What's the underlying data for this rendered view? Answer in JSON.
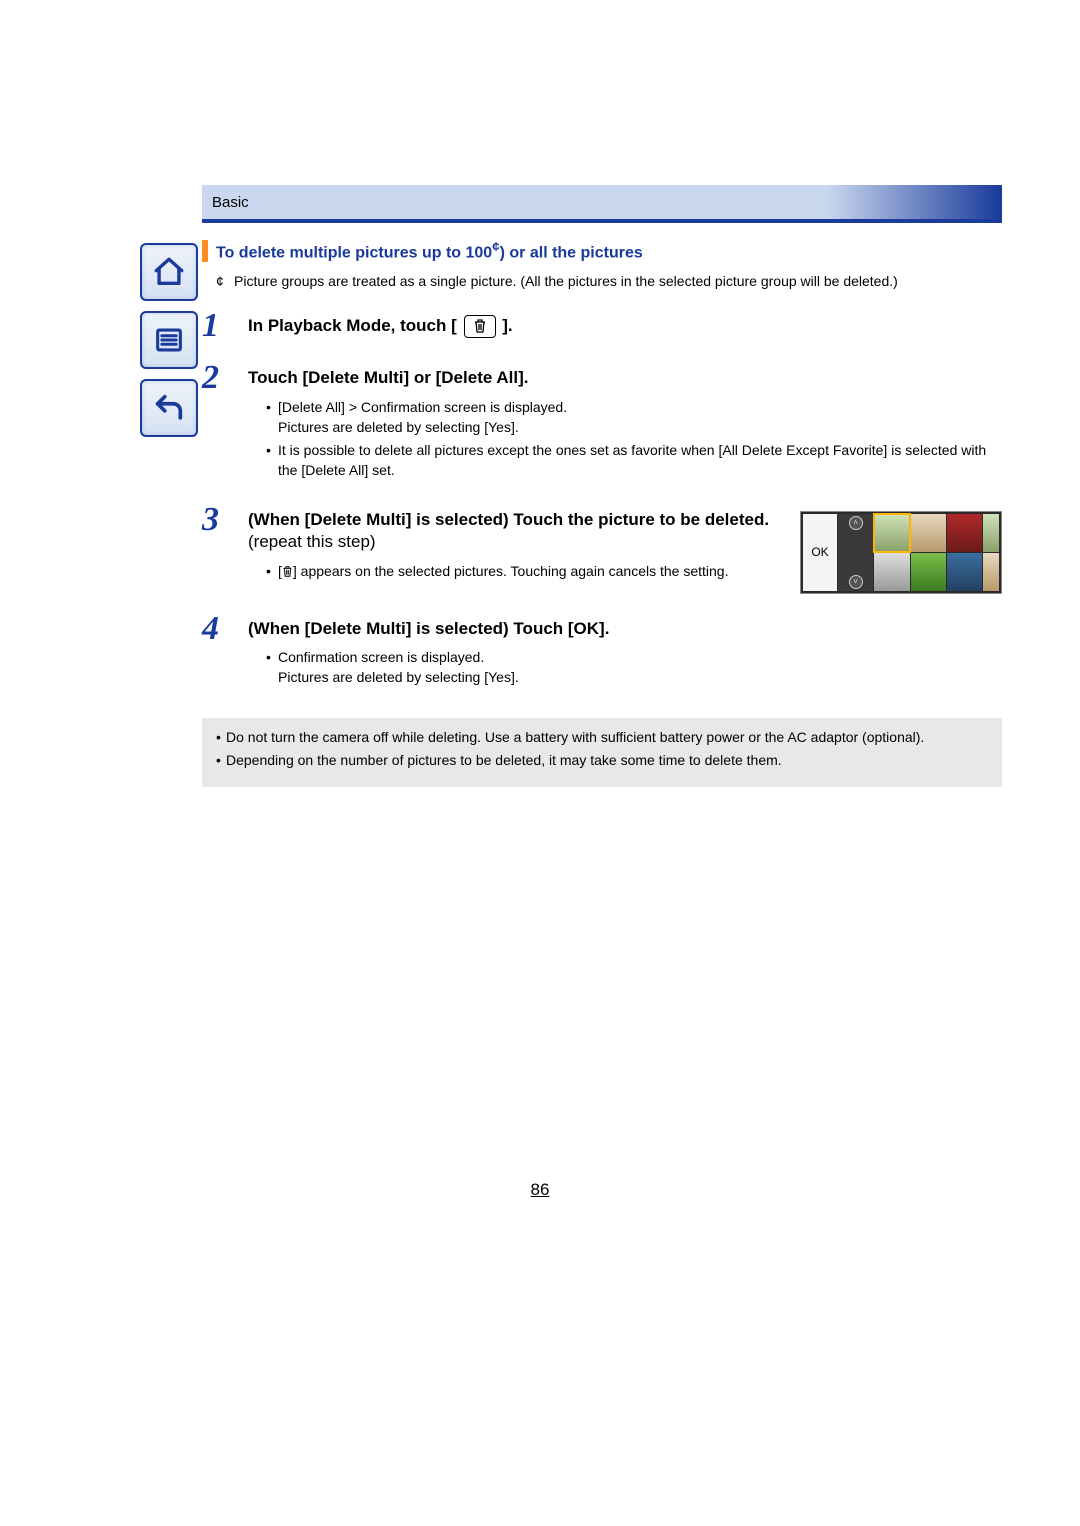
{
  "header": {
    "section": "Basic"
  },
  "heading": {
    "prefix": "To delete multiple pictures up to 100",
    "suffix": ") or all the pictures"
  },
  "footnote": {
    "mark": "¢",
    "text": "Picture groups are treated as a single picture. (All the pictures in the selected picture group will be deleted.)"
  },
  "steps": {
    "s1": {
      "num": "1",
      "t_before": "In Playback Mode, touch [",
      "t_after": "]."
    },
    "s2": {
      "num": "2",
      "title": "Touch [Delete Multi] or [Delete All].",
      "b1_a": "[Delete All] ",
      "b1_b": " Confirmation screen is displayed.",
      "b1_c": "Pictures are deleted by selecting [Yes].",
      "b2": "It is possible to delete all pictures except the ones set as favorite when [All Delete Except Favorite] is selected with the [Delete All] set."
    },
    "s3": {
      "num": "3",
      "title_bold": "When [Delete Multi] is selected) Touch the picture to be deleted.",
      "title_normal": " (repeat this step)",
      "b1_a": "[",
      "b1_b": "] appears on the selected pictures. Touching again cancels the setting."
    },
    "s4": {
      "num": "4",
      "title": "When [Delete Multi] is selected) Touch [OK].",
      "b1": "Confirmation screen is displayed.",
      "b2": "Pictures are deleted by selecting [Yes]."
    }
  },
  "thumb": {
    "ok": "OK"
  },
  "notes": {
    "n1": "Do not turn the camera off while deleting. Use a battery with sufficient battery power or the AC adaptor (optional).",
    "n2": "Depending on the number of pictures to be deleted, it may take some time to delete them."
  },
  "page_number": "86",
  "glyphs": {
    "arrow_right": ">",
    "footnote_mark_sup": "¢"
  }
}
